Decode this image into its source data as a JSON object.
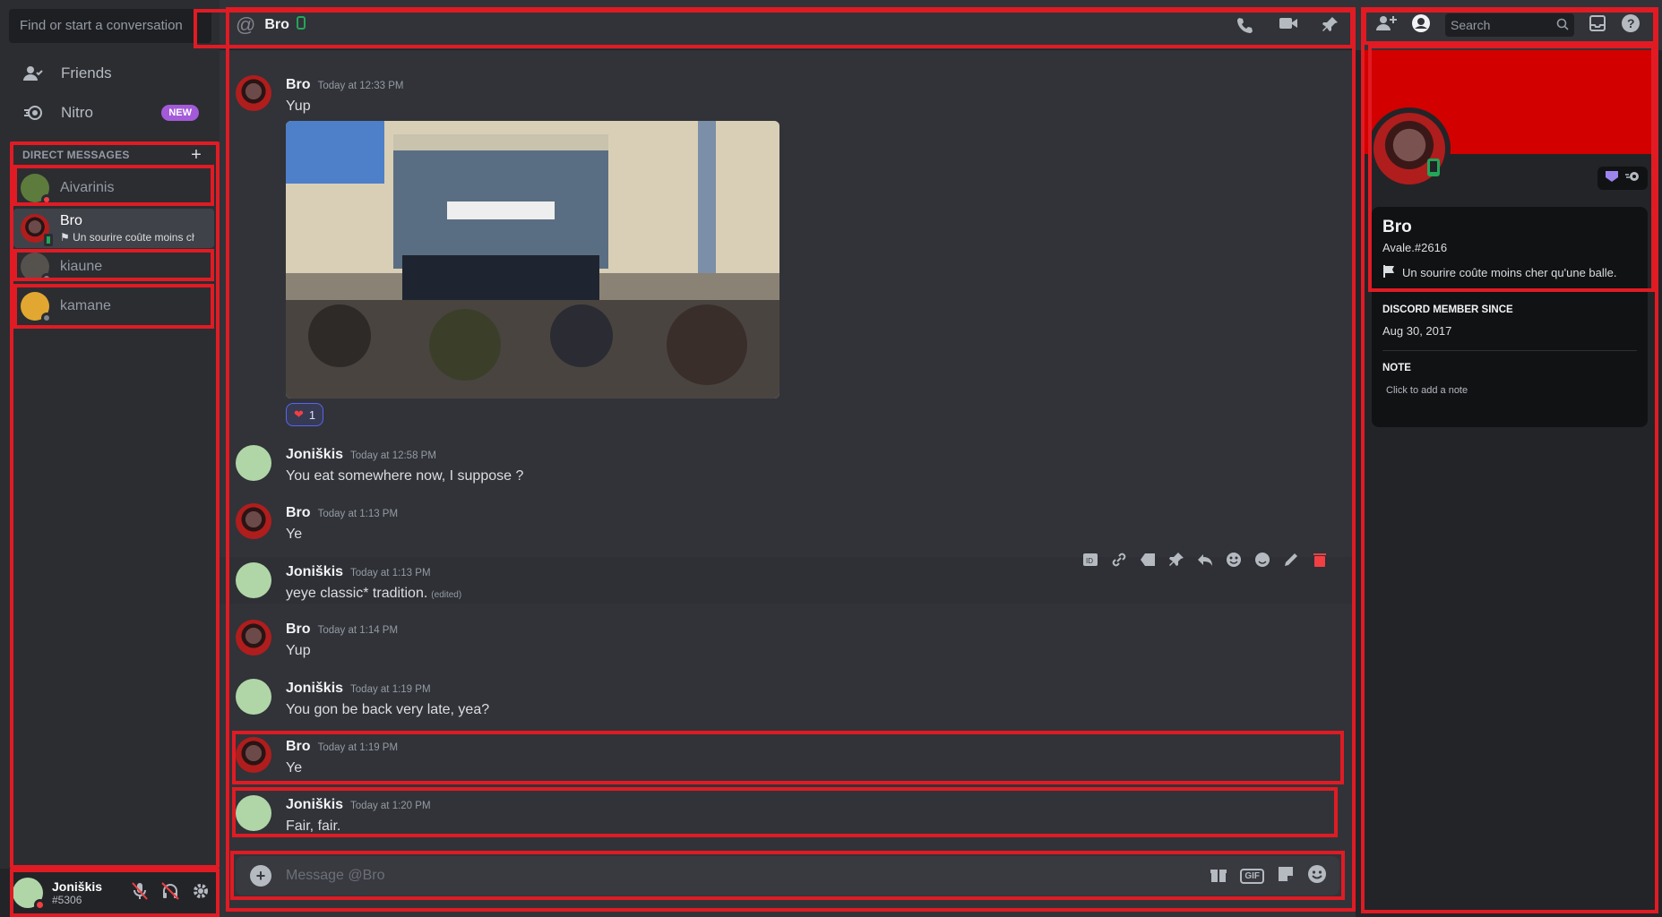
{
  "sidebar": {
    "search_placeholder": "Find or start a conversation",
    "friends_label": "Friends",
    "nitro_label": "Nitro",
    "nitro_badge": "NEW",
    "dm_header": "DIRECT MESSAGES",
    "dms": [
      {
        "name": "Aivarinis",
        "status": "dnd",
        "subtitle": ""
      },
      {
        "name": "Bro",
        "status": "mobile",
        "subtitle": "Un sourire coûte moins ch..."
      },
      {
        "name": "kiaune",
        "status": "offline",
        "subtitle": ""
      },
      {
        "name": "kamane",
        "status": "offline",
        "subtitle": ""
      }
    ],
    "user": {
      "name": "Joniškis",
      "tag": "#5306"
    }
  },
  "chat": {
    "recipient": "Bro",
    "composer_placeholder": "Message @Bro",
    "messages": [
      {
        "author": "Bro",
        "time": "Today at 12:33 PM",
        "text": "Yup",
        "reaction": {
          "emoji": "heart",
          "count": "1"
        }
      },
      {
        "author": "Joniškis",
        "time": "Today at 12:58 PM",
        "text": "You eat somewhere now, I suppose ?"
      },
      {
        "author": "Bro",
        "time": "Today at 1:13 PM",
        "text": "Ye"
      },
      {
        "author": "Joniškis",
        "time": "Today at 1:13 PM",
        "text": "yeye classic* tradition.",
        "edited": "(edited)"
      },
      {
        "author": "Bro",
        "time": "Today at 1:14 PM",
        "text": "Yup"
      },
      {
        "author": "Joniškis",
        "time": "Today at 1:19 PM",
        "text": "You gon be back very late, yea?"
      },
      {
        "author": "Bro",
        "time": "Today at 1:19 PM",
        "text": "Ye"
      },
      {
        "author": "Joniškis",
        "time": "Today at 1:20 PM",
        "text": "Fair, fair."
      }
    ]
  },
  "topbar": {
    "search_placeholder": "Search"
  },
  "profile": {
    "name": "Bro",
    "tag": "Avale.#2616",
    "custom_status": "Un sourire coûte moins cher qu'une balle.",
    "member_since_title": "DISCORD MEMBER SINCE",
    "member_since": "Aug 30, 2017",
    "note_title": "NOTE",
    "note_placeholder": "Click to add a note"
  },
  "colors": {
    "accent_red": "#e01b24",
    "banner": "#d30000",
    "online_green": "#23a55a",
    "dnd_red": "#f23f43",
    "nitro_purple": "#a35ad9"
  }
}
